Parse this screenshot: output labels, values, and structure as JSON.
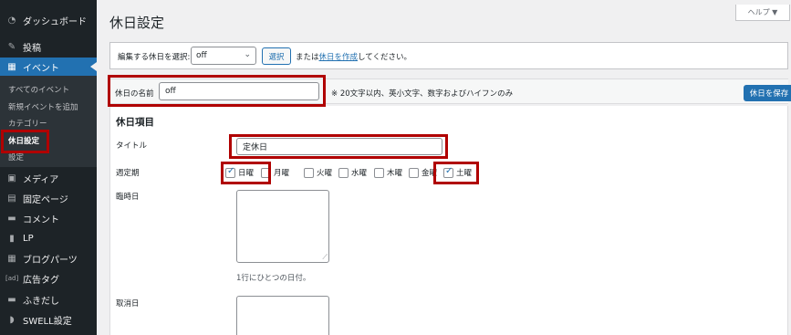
{
  "sidebar": {
    "dashboard": "ダッシュボード",
    "posts": "投稿",
    "events": "イベント",
    "sub_all": "すべてのイベント",
    "sub_add": "新規イベントを追加",
    "sub_category": "カテゴリー",
    "sub_holiday": "休日設定",
    "sub_settings": "設定",
    "media": "メディア",
    "pages": "固定ページ",
    "comments": "コメント",
    "lp": "LP",
    "blog_parts": "ブログパーツ",
    "ad_tags": "広告タグ",
    "balloon": "ふきだし",
    "swell": "SWELL設定",
    "ad_icon": "[ad]"
  },
  "header": {
    "title": "休日設定",
    "help": "ヘルプ ▼"
  },
  "selector": {
    "label": "編集する休日を選択:",
    "value": "off",
    "button": "選択",
    "text_before": "または",
    "create_link": "休日を作成",
    "text_after": "してください。"
  },
  "name_bar": {
    "label": "休日の名前",
    "value": "off",
    "hint": "※ 20文字以内、英小文字、数字およびハイフンのみ",
    "save": "休日を保存"
  },
  "form": {
    "section_title": "休日項目",
    "title_label": "タイトル",
    "title_value": "定休日",
    "weekly_label": "週定期",
    "days": [
      "日曜",
      "月曜",
      "火曜",
      "水曜",
      "木曜",
      "金曜",
      "土曜"
    ],
    "temp_label": "臨時日",
    "temp_hint": "1行にひとつの日付。",
    "cancel_label": "取消日"
  },
  "colors": {
    "accent": "#2271b1",
    "sidebar_bg": "#1d2327",
    "highlight": "#b00000"
  }
}
